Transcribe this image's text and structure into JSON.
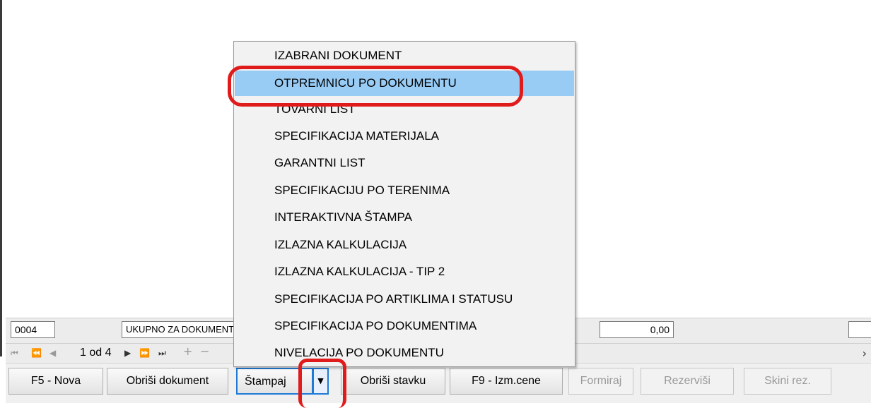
{
  "menu": {
    "items": [
      "IZABRANI DOKUMENT",
      "OTPREMNICU PO DOKUMENTU",
      "TOVARNI LIST",
      "SPECIFIKACIJA MATERIJALA",
      "GARANTNI LIST",
      "SPECIFIKACIJU PO TERENIMA",
      "INTERAKTIVNA ŠTAMPA",
      "IZLAZNA KALKULACIJA",
      "IZLAZNA KALKULACIJA - TIP 2",
      "SPECIFIKACIJA PO ARTIKLIMA I STATUSU",
      "SPECIFIKACIJA PO DOKUMENTIMA",
      "NIVELACIJA PO DOKUMENTU"
    ],
    "highlighted_index": 1
  },
  "summary": {
    "code": "0004",
    "label": "UKUPNO ZA DOKUMENT",
    "total": "0,00"
  },
  "navigator": {
    "page_text": "1 od 4"
  },
  "buttons": {
    "new": "F5 - Nova",
    "delete_doc": "Obriši dokument",
    "print": "Štampaj",
    "delete_item": "Obriši stavku",
    "change_price": "F9 - Izm.cene",
    "form": "Formiraj",
    "reserve": "Rezerviši",
    "remove_res": "Skini rez."
  },
  "icons": {
    "nav_first": "first-record-icon",
    "nav_prev_page": "prev-page-icon",
    "nav_prev": "prev-record-icon",
    "nav_next": "next-record-icon",
    "nav_next_page": "next-page-icon",
    "nav_last": "last-record-icon",
    "nav_add": "add-record-icon",
    "nav_delete": "delete-record-icon",
    "dropdown": "dropdown-arrow-icon",
    "scroll_right": "scroll-right-icon"
  },
  "colors": {
    "highlight": "#99ccf5",
    "annotation": "#e01b1b",
    "focus": "#1f7ad6"
  }
}
